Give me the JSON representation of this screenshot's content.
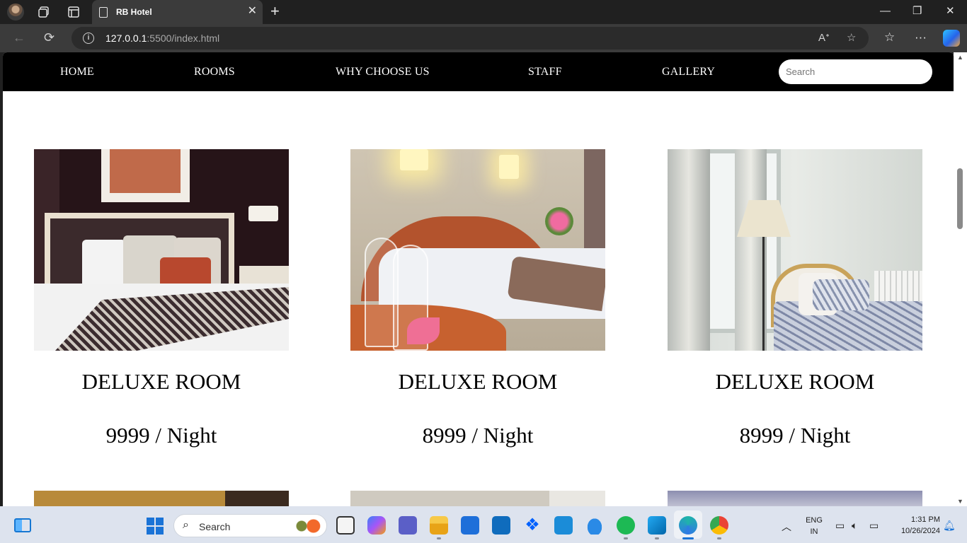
{
  "browser": {
    "tab_title": "RB Hotel",
    "tab_close": "✕",
    "new_tab": "+",
    "url_host": "127.0.0.1",
    "url_rest": ":5500/index.html",
    "minimize": "—",
    "restore": "❐",
    "close": "✕"
  },
  "site": {
    "nav": [
      "HOME",
      "ROOMS",
      "WHY CHOOSE US",
      "STAFF",
      "GALLERY"
    ],
    "search_placeholder": "Search",
    "rooms": [
      {
        "title": "DELUXE ROOM",
        "price": "9999 / Night"
      },
      {
        "title": "DELUXE ROOM",
        "price": "8999 / Night"
      },
      {
        "title": "DELUXE ROOM",
        "price": "8999 / Night"
      }
    ]
  },
  "taskbar": {
    "search_label": "Search",
    "lang_1": "ENG",
    "lang_2": "IN",
    "time": "1:31 PM",
    "date": "10/26/2024"
  },
  "colors": {
    "nav_bg": "#000000",
    "nav_text": "#ffffff",
    "page_bg": "#ffffff",
    "browser_chrome": "#202020"
  }
}
